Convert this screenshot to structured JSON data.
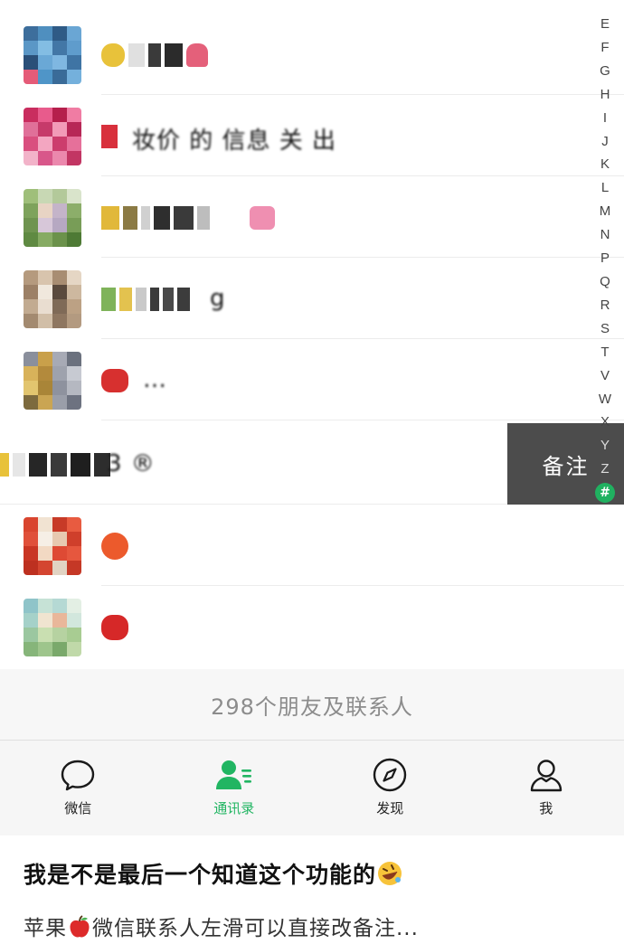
{
  "index_bar": {
    "letters": [
      "E",
      "F",
      "G",
      "H",
      "I",
      "J",
      "K",
      "L",
      "M",
      "N",
      "P",
      "Q",
      "R",
      "S",
      "T",
      "V",
      "W",
      "X",
      "Y",
      "Z"
    ],
    "hash": "#"
  },
  "contacts": [
    {
      "name": "",
      "blurred": true
    },
    {
      "name": "妆价 的 信息 关 出",
      "blurred": true
    },
    {
      "name": "",
      "blurred": true
    },
    {
      "name": "g",
      "blurred": true
    },
    {
      "name": "…",
      "blurred": true
    },
    {
      "name": "3 ®",
      "blurred": true,
      "swiped": true
    },
    {
      "name": "",
      "blurred": true
    },
    {
      "name": "",
      "blurred": true
    }
  ],
  "swipe_action": {
    "label": "备注"
  },
  "count": {
    "text": "298个朋友及联系人"
  },
  "tabbar": {
    "tabs": [
      {
        "label": "微信",
        "icon": "chat-bubble-icon",
        "active": false
      },
      {
        "label": "通讯录",
        "icon": "contacts-icon",
        "active": true
      },
      {
        "label": "发现",
        "icon": "compass-icon",
        "active": false
      },
      {
        "label": "我",
        "icon": "person-icon",
        "active": false
      }
    ]
  },
  "colors": {
    "accent_green": "#21b562",
    "swipe_bg": "#4c4c4c",
    "count_bg": "#f7f7f7"
  },
  "post": {
    "title": "我是不是最后一个知道这个功能的",
    "title_emoji": "rolling-laughing-emoji",
    "body_prefix": "苹果",
    "body_emoji": "apple-emoji",
    "body_suffix": "微信联系人左滑可以直接改备注..."
  }
}
